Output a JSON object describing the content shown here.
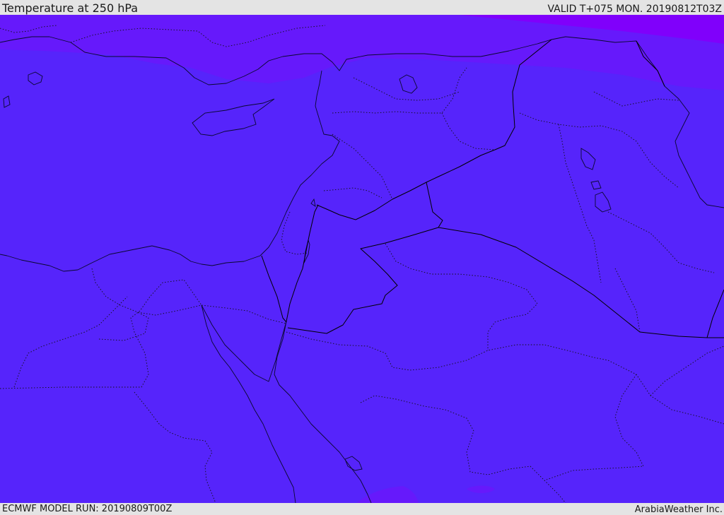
{
  "header": {
    "title": "Temperature at 250 hPa",
    "valid_time": "VALID T+075 MON. 20190812T03Z"
  },
  "footer": {
    "model_run": "ECMWF MODEL RUN: 20190809T00Z",
    "credit": "ArabiaWeather Inc."
  },
  "map": {
    "base_fill_color": "#5624fb",
    "cooler_band_color": "#6619fb",
    "coldest_band_color": "#8000fb"
  }
}
